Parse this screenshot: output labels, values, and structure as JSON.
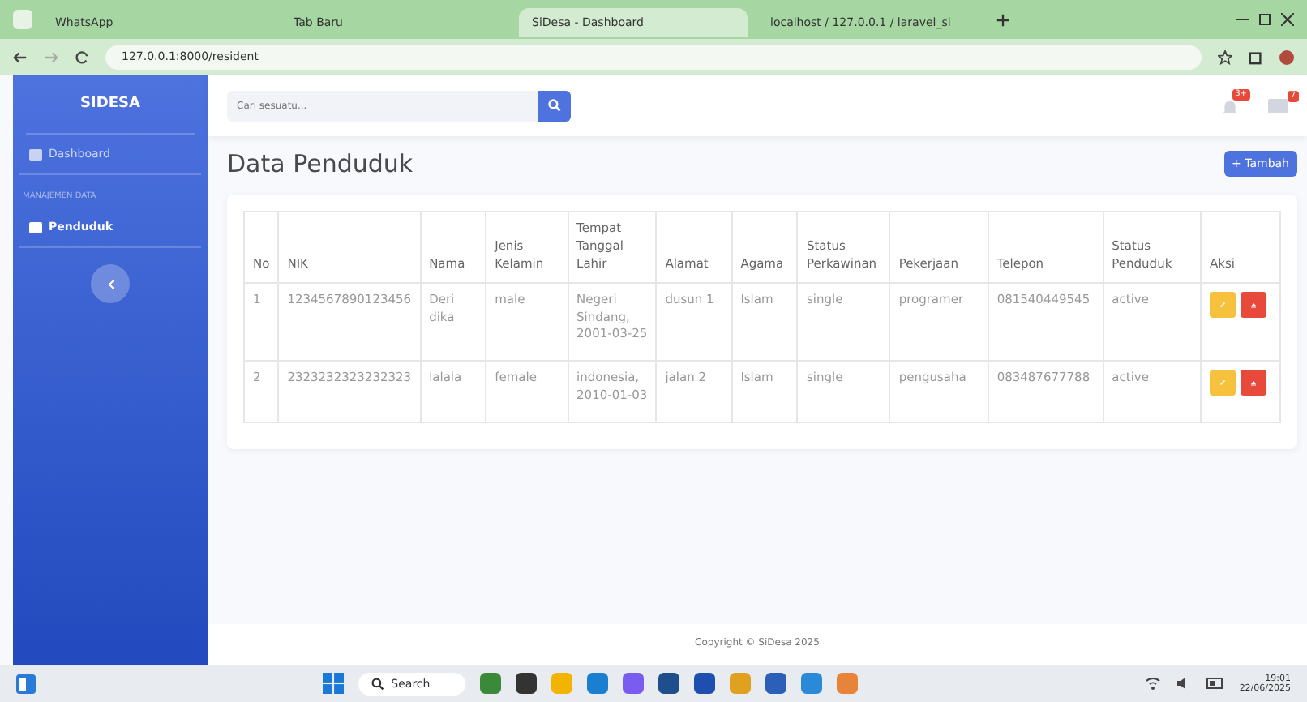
{
  "browser": {
    "tabs": [
      {
        "title": "WhatsApp",
        "selected": false
      },
      {
        "title": "Tab Baru",
        "selected": false
      },
      {
        "title": "SiDesa - Dashboard",
        "selected": true
      },
      {
        "title": "localhost / 127.0.0.1 / laravel_si",
        "selected": false
      }
    ],
    "url": "127.0.0.1:8000/resident"
  },
  "sidebar": {
    "brand": "SIDESA",
    "items": [
      {
        "kind": "link",
        "label": "Dashboard",
        "selected": false
      },
      {
        "kind": "heading",
        "label": "MANAJEMEN DATA"
      },
      {
        "kind": "link",
        "label": "Penduduk",
        "selected": true
      }
    ]
  },
  "topbar": {
    "search": {
      "placeholder": "Cari sesuatu..."
    },
    "alerts_badge": "3+",
    "messages_badge": "7"
  },
  "page": {
    "title": "Data Penduduk",
    "add_button": {
      "icon": "+",
      "label": "Tambah"
    }
  },
  "table": {
    "columns": [
      "No",
      "NIK",
      "Nama",
      "Jenis Kelamin",
      "Tempat Tanggal Lahir",
      "Alamat",
      "Agama",
      "Status Perkawinan",
      "Pekerjaan",
      "Telepon",
      "Status Penduduk",
      "Aksi"
    ],
    "rows": [
      [
        "1",
        "1234567890123456",
        "Deri dika",
        "male",
        "Negeri Sindang, 2001-03-25",
        "dusun 1",
        "Islam",
        "single",
        "programer",
        "081540449545",
        "active"
      ],
      [
        "2",
        "2323232323232323",
        "lalala",
        "female",
        "indonesia, 2010-01-03",
        "jalan 2",
        "Islam",
        "single",
        "pengusaha",
        "083487677788",
        "active"
      ]
    ]
  },
  "footer": "Copyright © SiDesa 2025",
  "taskbar": {
    "search": "Search",
    "time": "19:01",
    "date": "22/06/2025"
  }
}
